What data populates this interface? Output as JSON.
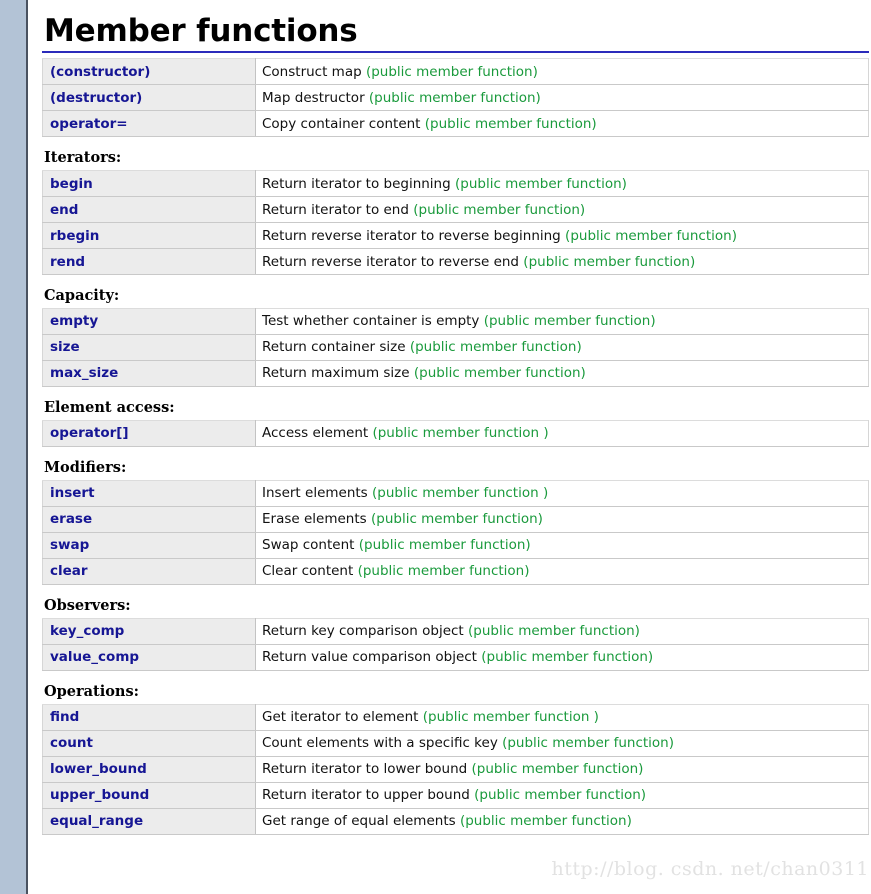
{
  "page": {
    "title": "Member functions",
    "watermark": "http://blog. csdn. net/chan0311"
  },
  "colors": {
    "left_strip": "#b3c3d6",
    "title_rule": "#2b2bbb",
    "function_name": "#161694",
    "annotation_green": "#1a9a3c",
    "name_cell_bg": "#ececec",
    "text": "#111111"
  },
  "sections": [
    {
      "heading": "",
      "rows": [
        {
          "name": "(constructor)",
          "desc": "Construct map ",
          "annot": "(public member function)"
        },
        {
          "name": "(destructor)",
          "desc": "Map destructor ",
          "annot": "(public member function)"
        },
        {
          "name": "operator=",
          "desc": "Copy container content ",
          "annot": "(public member function)"
        }
      ]
    },
    {
      "heading": "Iterators:",
      "rows": [
        {
          "name": "begin",
          "desc": "Return iterator to beginning ",
          "annot": "(public member function)"
        },
        {
          "name": "end",
          "desc": "Return iterator to end ",
          "annot": "(public member function)"
        },
        {
          "name": "rbegin",
          "desc": "Return reverse iterator to reverse beginning ",
          "annot": "(public member function)"
        },
        {
          "name": "rend",
          "desc": "Return reverse iterator to reverse end ",
          "annot": "(public member function)"
        }
      ]
    },
    {
      "heading": "Capacity:",
      "rows": [
        {
          "name": "empty",
          "desc": "Test whether container is empty ",
          "annot": "(public member function)"
        },
        {
          "name": "size",
          "desc": "Return container size ",
          "annot": "(public member function)"
        },
        {
          "name": "max_size",
          "desc": "Return maximum size ",
          "annot": "(public member function)"
        }
      ]
    },
    {
      "heading": "Element access:",
      "rows": [
        {
          "name": "operator[]",
          "desc": "Access element ",
          "annot": "(public member function )"
        }
      ]
    },
    {
      "heading": "Modifiers:",
      "rows": [
        {
          "name": "insert",
          "desc": "Insert elements ",
          "annot": "(public member function )"
        },
        {
          "name": "erase",
          "desc": "Erase elements ",
          "annot": "(public member function)"
        },
        {
          "name": "swap",
          "desc": "Swap content ",
          "annot": "(public member function)"
        },
        {
          "name": "clear",
          "desc": "Clear content ",
          "annot": "(public member function)"
        }
      ]
    },
    {
      "heading": "Observers:",
      "rows": [
        {
          "name": "key_comp",
          "desc": "Return key comparison object ",
          "annot": "(public member function)"
        },
        {
          "name": "value_comp",
          "desc": "Return value comparison object ",
          "annot": "(public member function)"
        }
      ]
    },
    {
      "heading": "Operations:",
      "rows": [
        {
          "name": "find",
          "desc": "Get iterator to element ",
          "annot": "(public member function )"
        },
        {
          "name": "count",
          "desc": "Count elements with a specific key ",
          "annot": "(public member function)"
        },
        {
          "name": "lower_bound",
          "desc": "Return iterator to lower bound ",
          "annot": "(public member function)"
        },
        {
          "name": "upper_bound",
          "desc": "Return iterator to upper bound ",
          "annot": "(public member function)"
        },
        {
          "name": "equal_range",
          "desc": "Get range of equal elements ",
          "annot": "(public member function)"
        }
      ]
    }
  ]
}
